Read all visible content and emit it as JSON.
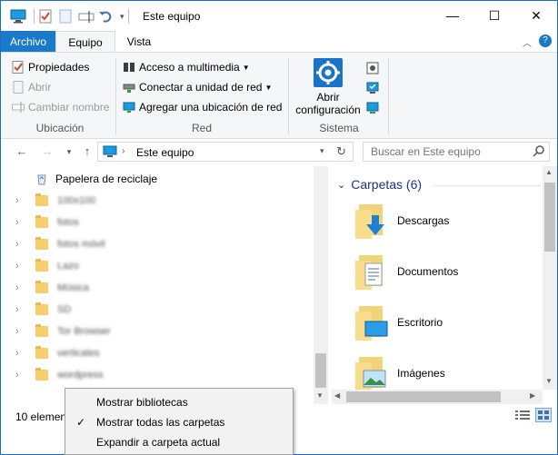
{
  "window": {
    "title": "Este equipo",
    "minimize_glyph": "—",
    "maximize_glyph": "☐",
    "close_glyph": "✕"
  },
  "ribbon_tabs": {
    "file": "Archivo",
    "equipo": "Equipo",
    "vista": "Vista"
  },
  "ribbon": {
    "ubicacion": {
      "label": "Ubicación",
      "propiedades": "Propiedades",
      "abrir": "Abrir",
      "cambiar_nombre": "Cambiar nombre"
    },
    "red": {
      "label": "Red",
      "acceso_multimedia": "Acceso a multimedia",
      "conectar_unidad": "Conectar a unidad de red",
      "agregar_ubicacion": "Agregar una ubicación de red"
    },
    "sistema": {
      "label": "Sistema",
      "abrir_configuracion_1": "Abrir",
      "abrir_configuracion_2": "configuración"
    }
  },
  "address": {
    "path": "Este equipo",
    "search_placeholder": "Buscar en Este equipo"
  },
  "navpane": {
    "recycle_bin": "Papelera de reciclaje",
    "folders": [
      "100x100",
      "fotos",
      "fotos móvil",
      "Lazo",
      "Música",
      "SD",
      "Tor Browser",
      "verticales",
      "wordpress"
    ]
  },
  "content": {
    "group_title": "Carpetas (6)",
    "folders": [
      "Descargas",
      "Documentos",
      "Escritorio",
      "Imágenes"
    ]
  },
  "status": {
    "items": "10 elemen"
  },
  "context_menu": {
    "items": [
      "Mostrar bibliotecas",
      "Mostrar todas las carpetas",
      "Expandir a carpeta actual"
    ],
    "checked_index": 1,
    "check_glyph": "✓"
  },
  "colors": {
    "accent": "#1979ca",
    "group_title": "#1e3287",
    "folder": "#f5cf6b"
  }
}
